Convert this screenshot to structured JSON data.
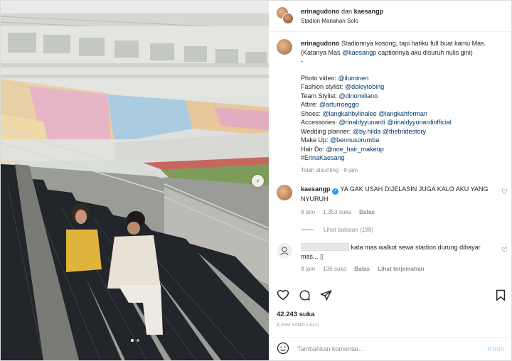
{
  "header": {
    "user": "erinagudono",
    "joiner": "dan",
    "collab": "kaesangp",
    "location": "Stadion Manahan Solo"
  },
  "caption": {
    "user": "erinagudono",
    "text": "Stadionnya kosong, tapi hatiku full buat kamu Mas. (Katanya Mas ",
    "mention": "@kaesangp",
    "text2": " captionnya aku disuruh nulis gini)",
    "dash": "-",
    "credits": [
      {
        "label": "Photo video: ",
        "handles": "@iluminen"
      },
      {
        "label": "Fashion stylist: ",
        "handles": "@doleytobing"
      },
      {
        "label": "Team Stylist: ",
        "handles": "@dinomiliano"
      },
      {
        "label": "Attire: ",
        "handles": "@arturroeggo"
      },
      {
        "label": "Shoes: ",
        "handles": "@langkahbylinalee @langkahforman"
      },
      {
        "label": "Accessories: ",
        "handles": "@rinaldyyunardi @rinaldyyunardiofficial"
      },
      {
        "label": "Wedding planner: ",
        "handles": "@by.hilda @thebridestory"
      },
      {
        "label": "Make Up: ",
        "handles": "@bennusorumba"
      },
      {
        "label": "Hair Do: ",
        "handles": "@noe_hair_makeup"
      }
    ],
    "hashtag": "#ErinaKaesang",
    "edited": "Telah disunting · 8 jam"
  },
  "comment1": {
    "user": "kaesangp",
    "text": "YA GAK USAH DIJELASIN JUGA KALO AKU YANG NYURUH",
    "time": "8 jam",
    "likes": "1.353 suka",
    "reply": "Balas",
    "view_replies": "Lihat balasan (198)"
  },
  "comment2": {
    "text": "kata mas walkot sewa stadion durung dibayar mas... ▯",
    "time": "8 jam",
    "likes": "136 suka",
    "reply": "Balas",
    "translate": "Lihat terjemahan"
  },
  "stats": {
    "likes": "42.243 suka",
    "ago": "8 JAM YANG LALU"
  },
  "add_comment": {
    "placeholder": "Tambahkan komentar...",
    "post": "Kirim"
  },
  "icons": {
    "like": "heart-icon",
    "comment": "comment-bubble-icon",
    "share": "paper-plane-icon",
    "save": "bookmark-icon",
    "emoji": "smiley-icon",
    "next": "chevron-right-icon",
    "verified": "verified-badge-icon"
  },
  "colors": {
    "link": "#00376b",
    "verified": "#3897f0",
    "post_button": "#b2dffc"
  },
  "carousel": {
    "slides": 2,
    "active": 1
  }
}
